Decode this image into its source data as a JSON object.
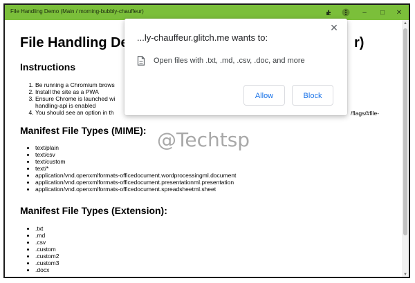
{
  "window": {
    "title": "File Handling Demo (Main / morning-bubbly-chauffeur)",
    "titlebar_color": "#7bbf3a",
    "controls": {
      "extensions_icon": "puzzle-icon",
      "menu_icon": "kebab-menu-icon",
      "minimize_glyph": "–",
      "maximize_glyph": "□",
      "close_glyph": "✕"
    }
  },
  "page": {
    "title": "File Handling Dem",
    "title_tail": "r)",
    "instructions": {
      "heading": "Instructions",
      "items": [
        "Be running a Chromium brows",
        "Install the site as a PWA",
        "Ensure Chrome is launched wi",
        "You should see an option in th"
      ],
      "item3_continuation": "handling-api is enabled",
      "item3_tail": "/flags/#file-"
    },
    "mime": {
      "heading": "Manifest File Types (MIME):",
      "items": [
        "text/plain",
        "text/csv",
        "text/custom",
        "text/*",
        "application/vnd.openxmlformats-officedocument.wordprocessingml.document",
        "application/vnd.openxmlformats-officedocument.presentationml.presentation",
        "application/vnd.openxmlformats-officedocument.spreadsheetml.sheet"
      ]
    },
    "extension": {
      "heading": "Manifest File Types (Extension):",
      "items": [
        ".txt",
        ".md",
        ".csv",
        ".custom",
        ".custom2",
        ".custom3",
        ".docx"
      ]
    }
  },
  "permission_dialog": {
    "origin_title": "...ly-chauffeur.glitch.me wants to:",
    "close_glyph": "✕",
    "permission_icon": "file-icon",
    "message": "Open files with .txt, .md, .csv, .doc, and more",
    "allow_label": "Allow",
    "block_label": "Block",
    "accent_color": "#1a73e8"
  },
  "watermark": "@Techtsp"
}
